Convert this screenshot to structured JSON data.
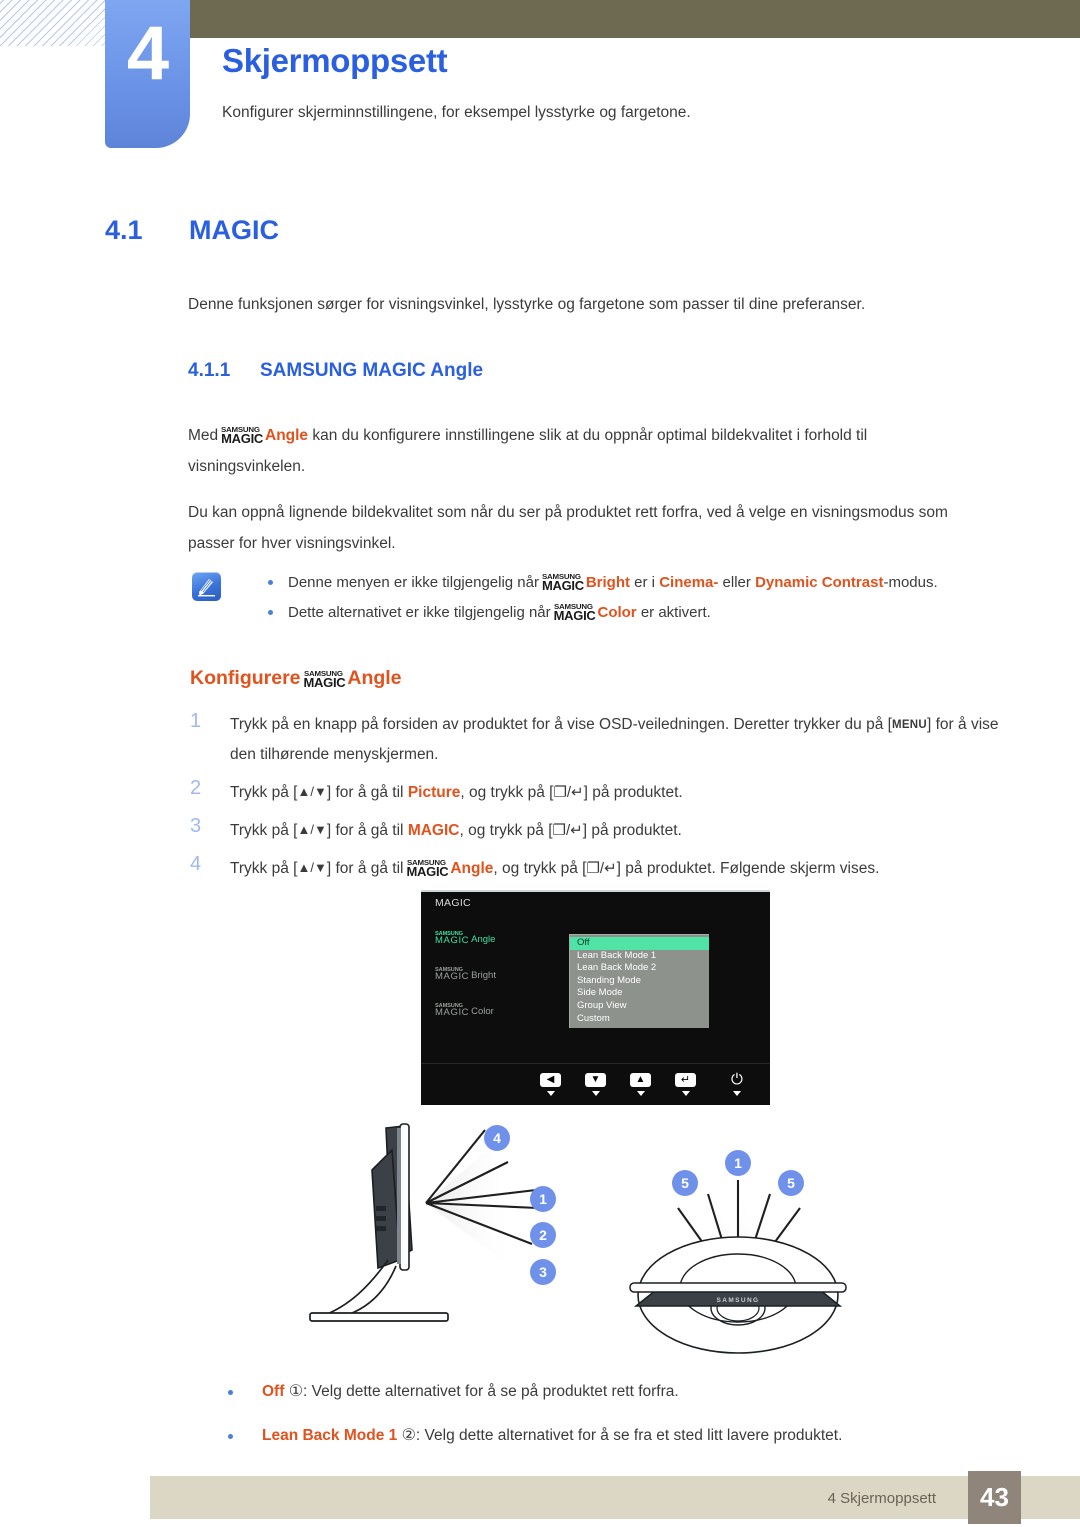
{
  "header": {
    "chapter_number": "4",
    "chapter_title": "Skjermoppsett",
    "chapter_description": "Konfigurer skjerminnstillingene, for eksempel lysstyrke og fargetone."
  },
  "section": {
    "number": "4.1",
    "title": "MAGIC",
    "intro": "Denne funksjonen sørger for visningsvinkel, lysstyrke og fargetone som passer til dine preferanser.",
    "subsection_number": "4.1.1",
    "subsection_title": "SAMSUNG MAGIC Angle"
  },
  "logo": {
    "top": "SAMSUNG",
    "bottom": "MAGIC"
  },
  "body": {
    "p1_prefix": "Med",
    "p1_feature": "Angle",
    "p1_rest": "kan du konfigurere innstillingene slik at du oppnår optimal bildekvalitet i forhold til visningsvinkelen.",
    "p2": "Du kan oppnå lignende bildekvalitet som når du ser på produktet rett forfra, ved å velge en visningsmodus som passer for hver visningsvinkel."
  },
  "notes": [
    {
      "prefix": "Denne menyen er ikke tilgjengelig når",
      "feature": "Bright",
      "mid": "er i",
      "mode1": "Cinema-",
      "conj": "eller",
      "mode2": "Dynamic Contrast",
      "suffix": "-modus."
    },
    {
      "prefix": "Dette alternativet er ikke tilgjengelig når",
      "feature": "Color",
      "suffix": "er aktivert."
    }
  ],
  "configure_heading": {
    "prefix": "Konfigurere",
    "feature": "Angle"
  },
  "steps": [
    {
      "number": "1",
      "text_a": "Trykk på en knapp på forsiden av produktet for å vise OSD-veiledningen. Deretter trykker du på [",
      "key": "MENU",
      "text_b": "] for å vise den tilhørende menyskjermen."
    },
    {
      "number": "2",
      "text_a": "Trykk på [",
      "arrows": "▲/▼",
      "text_b": "] for å gå til",
      "target": "Picture",
      "text_c": ", og trykk på [",
      "buttons": "❐/↵",
      "text_d": "] på produktet."
    },
    {
      "number": "3",
      "text_a": "Trykk på [",
      "arrows": "▲/▼",
      "text_b": "] for å gå til",
      "target": "MAGIC",
      "text_c": ", og trykk på [",
      "buttons": "❐/↵",
      "text_d": "] på produktet."
    },
    {
      "number": "4",
      "text_a": "Trykk på [",
      "arrows": "▲/▼",
      "text_b": "] for å gå til",
      "target_logo": true,
      "target": "Angle",
      "text_c": ", og trykk på [",
      "buttons": "❐/↵",
      "text_d": "] på produktet. Følgende skjerm vises."
    }
  ],
  "osd": {
    "title": "MAGIC",
    "items": [
      {
        "logo_top": "SAMSUNG",
        "logo_bottom": "MAGIC",
        "name": "Angle",
        "active": true,
        "colon": ":"
      },
      {
        "logo_top": "SAMSUNG",
        "logo_bottom": "MAGIC",
        "name": "Bright",
        "active": false,
        "colon": ":"
      },
      {
        "logo_top": "SAMSUNG",
        "logo_bottom": "MAGIC",
        "name": "Color",
        "active": false,
        "colon": ":"
      }
    ],
    "options": [
      {
        "label": "Off",
        "selected": true
      },
      {
        "label": "Lean Back Mode 1",
        "selected": false
      },
      {
        "label": "Lean Back Mode 2",
        "selected": false
      },
      {
        "label": "Standing Mode",
        "selected": false
      },
      {
        "label": "Side Mode",
        "selected": false
      },
      {
        "label": "Group View",
        "selected": false
      },
      {
        "label": "Custom",
        "selected": false
      }
    ],
    "buttons": [
      "◀",
      "▼",
      "▲",
      "↵"
    ],
    "power_glyph": "⏻",
    "highlight_color": "#4fe3a6",
    "active_text_color": "#3fe0a0"
  },
  "diagram": {
    "brand": "SAMSUNG",
    "side_view_badges": [
      "4",
      "1",
      "2",
      "3"
    ],
    "top_view_badges": [
      "5",
      "1",
      "5"
    ],
    "badge_color": "#6f91ea"
  },
  "options_list": [
    {
      "name": "Off",
      "marker": "①",
      "description": ": Velg dette alternativet for å se på produktet rett forfra."
    },
    {
      "name": "Lean Back Mode 1",
      "marker": "②",
      "description": ": Velg dette alternativet for å se fra et sted litt lavere produktet."
    }
  ],
  "footer": {
    "text": "4 Skjermoppsett",
    "page": "43"
  },
  "colors": {
    "heading_blue": "#2a5fe0",
    "accent_orange": "#e2521d",
    "olive": "#6e6a52",
    "footer_bar": "#dcd6c4",
    "footer_page_box": "#8f857a"
  }
}
